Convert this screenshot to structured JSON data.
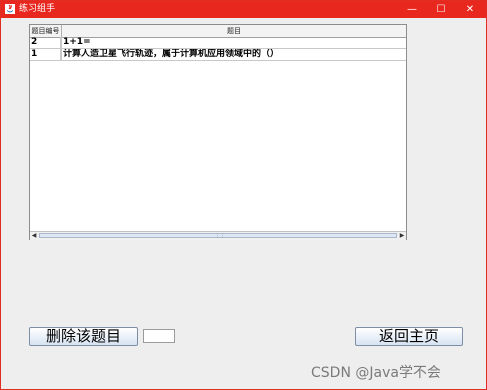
{
  "window": {
    "title": "练习组手",
    "controls": {
      "minimize": "—",
      "maximize": "☐",
      "close": "✕"
    }
  },
  "table": {
    "columns": [
      "题目编号",
      "题目"
    ],
    "rows": [
      {
        "id": "2",
        "question": "1+1="
      },
      {
        "id": "1",
        "question": "计算人造卫星飞行轨迹，属于计算机应用领域中的（）"
      }
    ],
    "hscroll": {
      "left_arrow": "◀",
      "right_arrow": "▶",
      "grip": "⋮⋮"
    }
  },
  "actions": {
    "delete_label": "删除该题目",
    "id_input_value": "",
    "home_label": "返回主页"
  },
  "watermark": "CSDN @Java学不会",
  "colors": {
    "titlebar": "#e8271f",
    "background": "#eeeeee"
  },
  "icons": {
    "app": "java-app-icon"
  }
}
